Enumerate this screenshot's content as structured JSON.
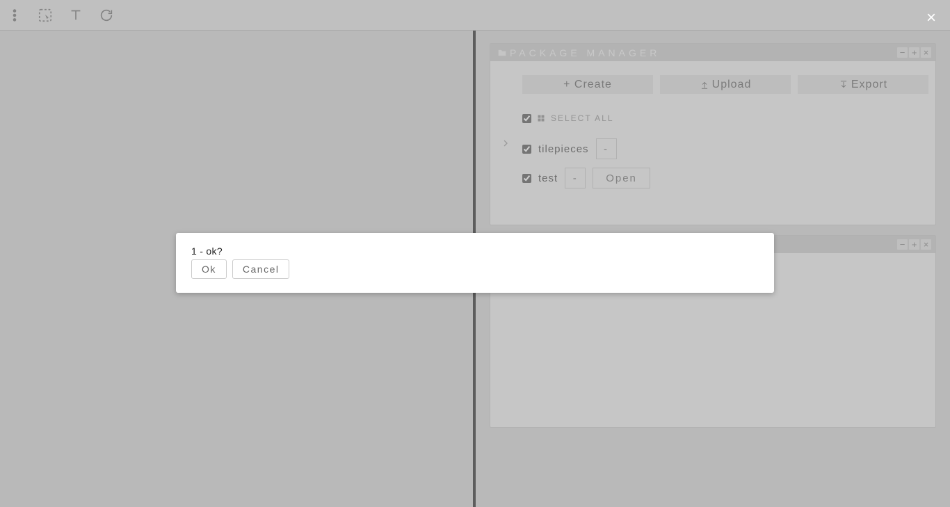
{
  "toolbar": {
    "icons": [
      "menu",
      "select-region",
      "text-tool",
      "refresh"
    ]
  },
  "rightPane": {
    "closeGlyph": "×",
    "panel1": {
      "title": "Package Manager",
      "winButtons": {
        "min": "−",
        "max": "+",
        "close": "×"
      },
      "actions": {
        "create": "+ Create",
        "upload": "Upload",
        "export": "Export"
      },
      "selectAll": "Select All",
      "packages": [
        {
          "name": "tilepieces",
          "minus": "-",
          "open": null
        },
        {
          "name": "test",
          "minus": "-",
          "open": "Open"
        }
      ]
    },
    "panel2": {
      "title": "",
      "winButtons": {
        "min": "−",
        "max": "+",
        "close": "×"
      }
    }
  },
  "alert": {
    "message": "1 - ok?",
    "ok": "Ok",
    "cancel": "Cancel"
  }
}
